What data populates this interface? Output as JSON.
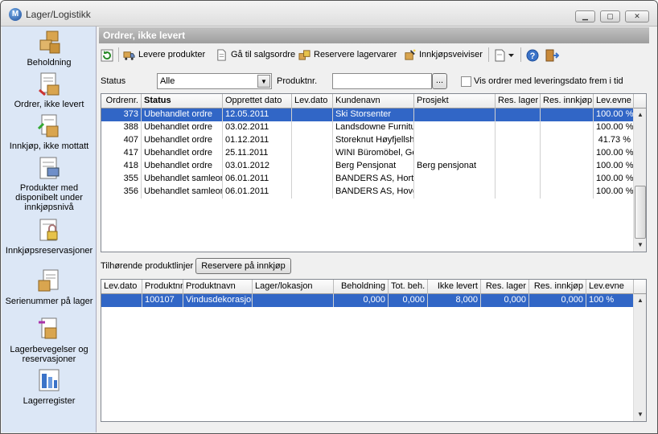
{
  "window": {
    "title": "Lager/Logistikk",
    "app_icon": "M"
  },
  "sidebar": {
    "items": [
      {
        "label": "Beholdning",
        "icon": "boxes-icon"
      },
      {
        "label": "Ordrer, ikke levert",
        "icon": "order-icon"
      },
      {
        "label": "Innkjøp, ikke mottatt",
        "icon": "purchase-icon"
      },
      {
        "label": "Produkter med disponibelt under innkjøpsnivå",
        "icon": "products-icon"
      },
      {
        "label": "Innkjøpsreservasjoner",
        "icon": "lock-icon"
      },
      {
        "label": "Serienummer på lager",
        "icon": "serial-icon"
      },
      {
        "label": "Lagerbevegelser og reservasjoner",
        "icon": "movement-icon"
      },
      {
        "label": "Lagerregister",
        "icon": "register-icon"
      }
    ]
  },
  "panel": {
    "title": "Ordrer, ikke levert"
  },
  "toolbar": {
    "refresh_icon": "refresh-icon",
    "deliver": "Levere produkter",
    "goto_sales": "Gå til salgsordre",
    "reserve": "Reservere lagervarer",
    "purchase_wizard": "Innkjøpsveiviser"
  },
  "filters": {
    "status_label": "Status",
    "status_value": "Alle",
    "product_label": "Produktnr.",
    "product_value": "",
    "browse": "...",
    "delivery_checkbox": "Vis ordrer med leveringsdato frem i tid",
    "delivery_checked": false
  },
  "orders": {
    "columns": [
      "Ordrenr.",
      "Status",
      "Opprettet dato",
      "Lev.dato",
      "Kundenavn",
      "Prosjekt",
      "Res. lager",
      "Res. innkjøp",
      "Lev.evne"
    ],
    "rows": [
      [
        "373",
        "Ubehandlet ordre",
        "12.05.2011",
        "",
        "Ski Storsenter",
        "",
        "",
        "",
        "100.00 %"
      ],
      [
        "388",
        "Ubehandlet ordre",
        "03.02.2011",
        "",
        "Landsdowne Furniture",
        "",
        "",
        "",
        "100.00 %"
      ],
      [
        "407",
        "Ubehandlet ordre",
        "01.12.2011",
        "",
        "Storeknut Høyfjellshotell",
        "",
        "",
        "",
        "41.73 %"
      ],
      [
        "417",
        "Ubehandlet ordre",
        "25.11.2011",
        "",
        "WINI Büromöbel, Ge",
        "",
        "",
        "",
        "100.00 %"
      ],
      [
        "418",
        "Ubehandlet ordre",
        "03.01.2012",
        "",
        "Berg Pensjonat",
        "Berg pensjonat",
        "",
        "",
        "100.00 %"
      ],
      [
        "355",
        "Ubehandlet samleordre",
        "06.01.2011",
        "",
        "BANDERS AS, Horten",
        "",
        "",
        "",
        "100.00 %"
      ],
      [
        "356",
        "Ubehandlet samleordre",
        "06.01.2011",
        "",
        "BANDERS AS, Hovedkontor",
        "",
        "",
        "",
        "100.00 %"
      ]
    ]
  },
  "lines_section": {
    "label": "Tilhørende produktlinjer",
    "reserve_button": "Reservere på innkjøp"
  },
  "lines": {
    "columns": [
      "Lev.dato",
      "Produktnr.",
      "Produktnavn",
      "Lager/lokasjon",
      "Beholdning",
      "Tot. beh.",
      "Ikke levert",
      "Res. lager",
      "Res. innkjøp",
      "Lev.evne"
    ],
    "rows": [
      [
        "",
        "100107",
        "Vindusdekorasjon",
        "",
        "0,000",
        "0,000",
        "8,000",
        "0,000",
        "0,000",
        "100 %"
      ]
    ]
  },
  "colors": {
    "selection": "#3166c6",
    "sidebar": "#dce7f6",
    "header": "#a8a8a8"
  }
}
